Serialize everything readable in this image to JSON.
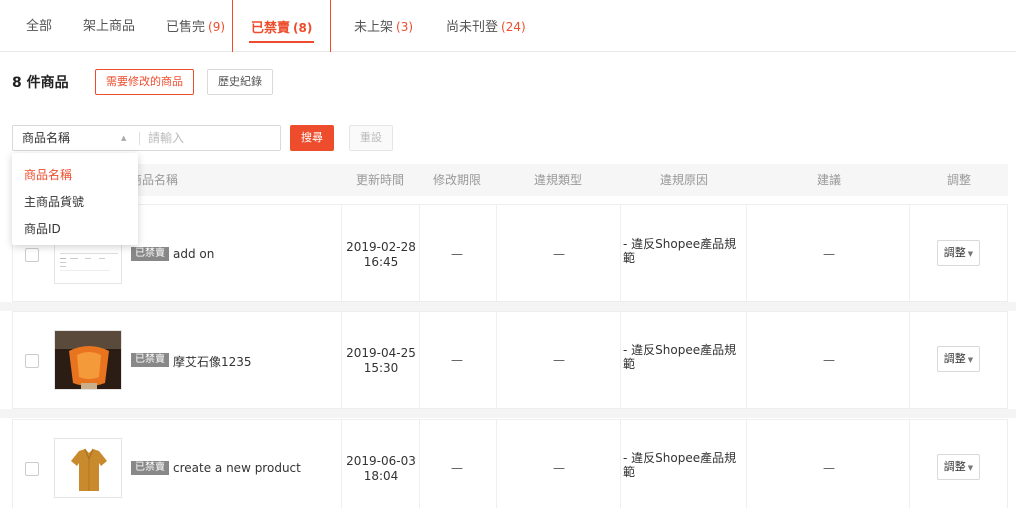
{
  "tabs": [
    {
      "label": "全部",
      "count": ""
    },
    {
      "label": "架上商品",
      "count": ""
    },
    {
      "label": "已售完",
      "count": "(9)"
    },
    {
      "label": "已禁賣",
      "count": "(8)"
    },
    {
      "label": "未上架",
      "count": "(3)"
    },
    {
      "label": "尚未刊登",
      "count": "(24)"
    }
  ],
  "summary": {
    "count_label": "8 件商品",
    "need_modify_button": "需要修改的商品",
    "history_button": "歷史紀錄"
  },
  "search": {
    "field_label": "商品名稱",
    "placeholder": "請輸入",
    "search_button": "搜尋",
    "reset_button": "重設",
    "dropdown_options": [
      "商品名稱",
      "主商品貨號",
      "商品ID"
    ]
  },
  "table": {
    "headers": [
      "商品名稱",
      "更新時間",
      "修改期限",
      "違規類型",
      "違規原因",
      "建議",
      "調整"
    ],
    "rows": [
      {
        "badge": "已禁賣",
        "name": "add on",
        "date": "2019-02-28",
        "time": "16:45",
        "deadline": "—",
        "type": "—",
        "reason": "- 違反Shopee產品規範",
        "suggestion": "—",
        "action": "調整",
        "thumb": "screenshot-thumbnail"
      },
      {
        "badge": "已禁賣",
        "name": "摩艾石像1235",
        "date": "2019-04-25",
        "time": "15:30",
        "deadline": "—",
        "type": "—",
        "reason": "- 違反Shopee產品規範",
        "suggestion": "—",
        "action": "調整",
        "thumb": "orange-figure-photo"
      },
      {
        "badge": "已禁賣",
        "name": "create a new product",
        "date": "2019-06-03",
        "time": "18:04",
        "deadline": "—",
        "type": "—",
        "reason": "- 違反Shopee產品規範",
        "suggestion": "—",
        "action": "調整",
        "thumb": "shirt-photo"
      }
    ]
  },
  "colors": {
    "accent": "#ee4d2d",
    "badge": "#888888",
    "header_bg": "#f6f6f6"
  }
}
